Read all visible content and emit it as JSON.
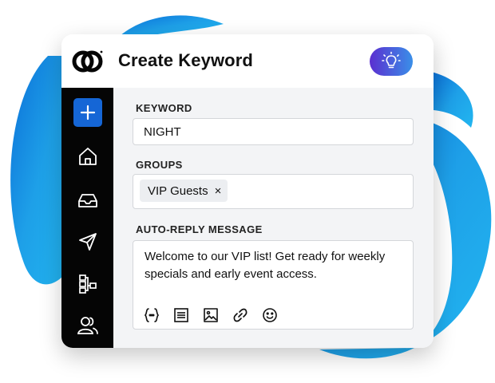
{
  "colors": {
    "sidebar": "#050505",
    "accent_blue": "#1566d6",
    "idea_gradient_start": "#5b2fd0",
    "idea_gradient_end": "#3a8fe8",
    "background_swoosh": "#1ea0e8"
  },
  "header": {
    "title": "Create Keyword",
    "logo": "brand-logo",
    "idea_button_icon": "lightbulb-icon"
  },
  "sidebar": {
    "items": [
      {
        "icon": "plus-icon",
        "active": true
      },
      {
        "icon": "home-icon"
      },
      {
        "icon": "inbox-icon"
      },
      {
        "icon": "send-icon"
      },
      {
        "icon": "workflow-icon"
      },
      {
        "icon": "contacts-icon"
      }
    ]
  },
  "form": {
    "keyword_label": "KEYWORD",
    "keyword_value": "NIGHT",
    "groups_label": "GROUPS",
    "groups_chips": [
      {
        "label": "VIP Guests",
        "remove": "×"
      }
    ],
    "message_label": "AUTO-REPLY MESSAGE",
    "message_text": "Welcome to our VIP list! Get ready for weekly specials and early event access.",
    "toolbar": [
      "variable-braces-icon",
      "template-icon",
      "image-icon",
      "link-icon",
      "emoji-icon"
    ]
  }
}
